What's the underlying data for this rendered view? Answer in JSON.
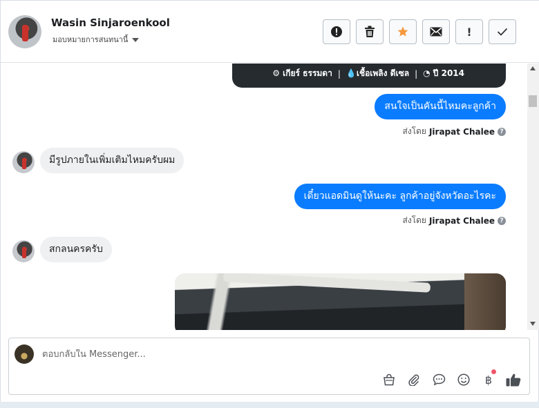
{
  "header": {
    "name": "Wasin Sinjaroenkool",
    "assign_label": "มอบหมายการสนทนานี้",
    "actions": [
      {
        "name": "alert-circle-icon"
      },
      {
        "name": "trash-icon"
      },
      {
        "name": "star-icon"
      },
      {
        "name": "envelope-icon"
      },
      {
        "label": "!"
      },
      {
        "name": "check-icon"
      }
    ],
    "star_color": "#f5993c"
  },
  "card": {
    "gear": "เกียร์ ธรรมดา",
    "fuel": "เชื้อเพลิง ดีเซล",
    "year": "ปี 2014",
    "sep": "|"
  },
  "messages": [
    {
      "direction": "out",
      "text": "สนใจเป็นคันนี้ไหมคะลูกค้า",
      "sent_by_prefix": "ส่งโดย",
      "sent_by": "Jirapat Chalee"
    },
    {
      "direction": "in",
      "text": "มีรูปภายในเพิ่มเติมไหมครับผม"
    },
    {
      "direction": "out",
      "text": "เดี๋ยวแอดมินดูให้นะคะ  ลูกค้าอยู่จังหวัดอะไรคะ",
      "sent_by_prefix": "ส่งโดย",
      "sent_by": "Jirapat Chalee"
    },
    {
      "direction": "in",
      "text": "สกลนครครับ"
    }
  ],
  "composer": {
    "placeholder": "ตอบกลับใน Messenger...",
    "baht_symbol": "฿",
    "tools": [
      "bag-icon",
      "paperclip-icon",
      "chat-bubble-icon",
      "smiley-icon",
      "baht-icon",
      "thumbs-up-icon"
    ]
  },
  "colors": {
    "outgoing_bubble": "#0a7cff",
    "incoming_bubble": "#eef0f2",
    "notification_dot": "#f0566a"
  }
}
